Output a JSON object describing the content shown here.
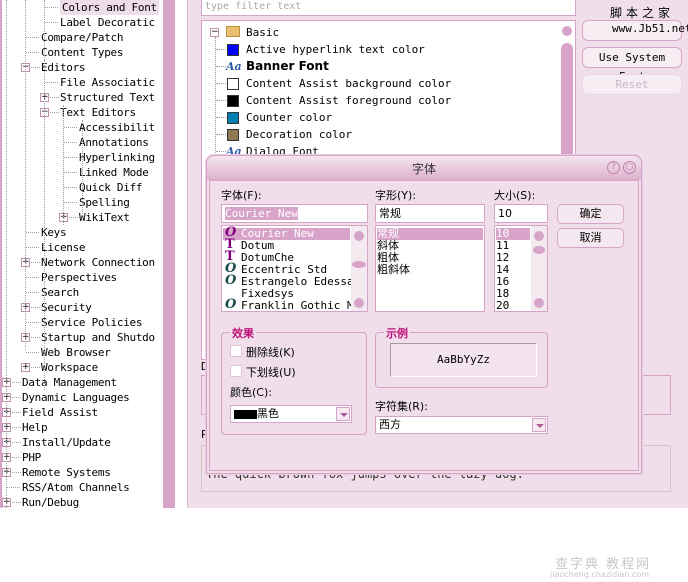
{
  "left_tree": {
    "items": [
      {
        "label": "Colors and Font",
        "level": 3,
        "expander": null,
        "selected": true
      },
      {
        "label": "Label Decoratic",
        "level": 3,
        "expander": null
      },
      {
        "label": "Compare/Patch",
        "level": 2,
        "expander": null
      },
      {
        "label": "Content Types",
        "level": 2,
        "expander": null
      },
      {
        "label": "Editors",
        "level": 2,
        "expander": "minus"
      },
      {
        "label": "File Associatic",
        "level": 3,
        "expander": null
      },
      {
        "label": "Structured Text",
        "level": 3,
        "expander": "plus"
      },
      {
        "label": "Text Editors",
        "level": 3,
        "expander": "minus"
      },
      {
        "label": "Accessibilit",
        "level": 4,
        "expander": null
      },
      {
        "label": "Annotations",
        "level": 4,
        "expander": null
      },
      {
        "label": "Hyperlinking",
        "level": 4,
        "expander": null
      },
      {
        "label": "Linked Mode",
        "level": 4,
        "expander": null
      },
      {
        "label": "Quick Diff",
        "level": 4,
        "expander": null
      },
      {
        "label": "Spelling",
        "level": 4,
        "expander": null
      },
      {
        "label": "WikiText",
        "level": 4,
        "expander": "plus"
      },
      {
        "label": "Keys",
        "level": 2,
        "expander": null
      },
      {
        "label": "License",
        "level": 2,
        "expander": null
      },
      {
        "label": "Network Connection",
        "level": 2,
        "expander": "plus"
      },
      {
        "label": "Perspectives",
        "level": 2,
        "expander": null
      },
      {
        "label": "Search",
        "level": 2,
        "expander": null
      },
      {
        "label": "Security",
        "level": 2,
        "expander": "plus"
      },
      {
        "label": "Service Policies",
        "level": 2,
        "expander": null
      },
      {
        "label": "Startup and Shutdo",
        "level": 2,
        "expander": "plus"
      },
      {
        "label": "Web Browser",
        "level": 2,
        "expander": null
      },
      {
        "label": "Workspace",
        "level": 2,
        "expander": "plus"
      },
      {
        "label": "Data Management",
        "level": 1,
        "expander": "plus"
      },
      {
        "label": "Dynamic Languages",
        "level": 1,
        "expander": "plus"
      },
      {
        "label": "Field Assist",
        "level": 1,
        "expander": "plus"
      },
      {
        "label": "Help",
        "level": 1,
        "expander": "plus"
      },
      {
        "label": "Install/Update",
        "level": 1,
        "expander": "plus"
      },
      {
        "label": "PHP",
        "level": 1,
        "expander": "plus"
      },
      {
        "label": "Remote Systems",
        "level": 1,
        "expander": "plus"
      },
      {
        "label": "RSS/Atom Channels",
        "level": 1,
        "expander": null
      },
      {
        "label": "Run/Debug",
        "level": 1,
        "expander": "plus"
      }
    ]
  },
  "filter": {
    "placeholder": "type filter text"
  },
  "colors_tree": {
    "category": "Basic",
    "items": [
      {
        "label": "Active hyperlink text color",
        "kind": "color",
        "color": "#0000ff"
      },
      {
        "label": "Banner Font",
        "kind": "font",
        "bold": true
      },
      {
        "label": "Content Assist background color",
        "kind": "color",
        "color": "#ffffff"
      },
      {
        "label": "Content Assist foreground color",
        "kind": "color",
        "color": "#000000"
      },
      {
        "label": "Counter color",
        "kind": "color",
        "color": "#0080b0"
      },
      {
        "label": "Decoration color",
        "kind": "color",
        "color": "#907850"
      },
      {
        "label": "Dialog Font",
        "kind": "font"
      }
    ],
    "font_icon_text": "Aa"
  },
  "side_buttons": {
    "edit": "",
    "use_system_font": "Use System Font",
    "reset": "Reset"
  },
  "watermark": {
    "top": "脚本之家",
    "url": "www.Jb51.net",
    "bottom": "查字典 教程网",
    "bottom_url": "jiaocheng.chazidian.com"
  },
  "description_label": "D",
  "preview_label": "P",
  "preview_text": "The quick brown fox jumps over the lazy dog.",
  "font_dialog": {
    "title": "字体",
    "help_icon": "?",
    "close_icon": "○",
    "font_label": "字体(F):",
    "style_label": "字形(Y):",
    "size_label": "大小(S):",
    "font_value": "Courier New",
    "style_value": "常规",
    "size_value": "10",
    "fonts": [
      {
        "name": "Courier New",
        "icon": "opentype",
        "selected": true
      },
      {
        "name": "Dotum",
        "icon": "truetype"
      },
      {
        "name": "DotumChe",
        "icon": "truetype"
      },
      {
        "name": "Eccentric Std",
        "icon": "opentype"
      },
      {
        "name": "Estrangelo Edessa",
        "icon": "opentype"
      },
      {
        "name": "Fixedsys",
        "icon": "none"
      },
      {
        "name": "Franklin Gothic Me",
        "icon": "opentype"
      }
    ],
    "styles": [
      {
        "name": "常规",
        "selected": true
      },
      {
        "name": "斜体"
      },
      {
        "name": "粗体"
      },
      {
        "name": "粗斜体"
      }
    ],
    "sizes": [
      {
        "name": "10",
        "selected": true
      },
      {
        "name": "11"
      },
      {
        "name": "12"
      },
      {
        "name": "14"
      },
      {
        "name": "16"
      },
      {
        "name": "18"
      },
      {
        "name": "20"
      }
    ],
    "ok_label": "确定",
    "cancel_label": "取消",
    "effects_title": "效果",
    "strikeout_label": "删除线(K)",
    "underline_label": "下划线(U)",
    "strikeout_checked": false,
    "underline_checked": false,
    "color_label": "颜色(C):",
    "color_value": "黑色",
    "color_swatch": "#000000",
    "sample_title": "示例",
    "sample_text": "AaBbYyZz",
    "charset_label": "字符集(R):",
    "charset_value": "西方"
  },
  "colors": {
    "accent": "#d7a3c8",
    "panel_bg": "#f0dfea",
    "group_title": "#c0107a"
  }
}
